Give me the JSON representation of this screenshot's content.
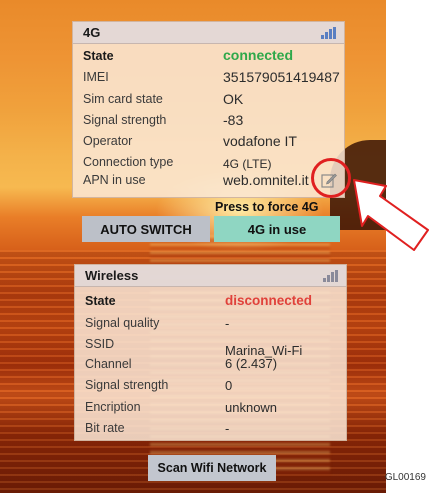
{
  "lte_panel": {
    "title": "4G",
    "rows": [
      {
        "label": "State",
        "value": "connected"
      },
      {
        "label": "IMEI",
        "value": "351579051419487"
      },
      {
        "label": "Sim card state",
        "value": "OK"
      },
      {
        "label": "Signal strength",
        "value": "-83"
      },
      {
        "label": "Operator",
        "value": "vodafone IT"
      },
      {
        "label": "Connection type",
        "value": "4G (LTE)"
      },
      {
        "label": "APN in use",
        "value": "web.omnitel.it"
      }
    ]
  },
  "force_hint": "Press to force 4G",
  "buttons": {
    "auto_switch": "AUTO SWITCH",
    "lte_in_use": "4G in use",
    "scan_wifi": "Scan Wifi Network"
  },
  "wireless_panel": {
    "title": "Wireless",
    "rows": [
      {
        "label": "State",
        "value": "disconnected"
      },
      {
        "label": "Signal quality",
        "value": "-"
      },
      {
        "label": "SSID",
        "value": "Marina_Wi-Fi"
      },
      {
        "label": "Channel",
        "value": "6 (2.437)"
      },
      {
        "label": "Signal strength",
        "value": "0"
      },
      {
        "label": "Encription",
        "value": "unknown"
      },
      {
        "label": "Bit rate",
        "value": "-"
      }
    ]
  },
  "figure_code": "GL00169",
  "colors": {
    "connected": "#2fa84a",
    "disconnected": "#e0413a",
    "lte_button": "#8fd6c2",
    "auto_button": "#bcc0c8",
    "scan_button": "#c2c6ce",
    "annotation": "#e02020"
  },
  "icons": {
    "signal": "signal-bars-icon",
    "edit": "edit-pencil-icon",
    "annotation_arrow": "arrow-icon"
  }
}
